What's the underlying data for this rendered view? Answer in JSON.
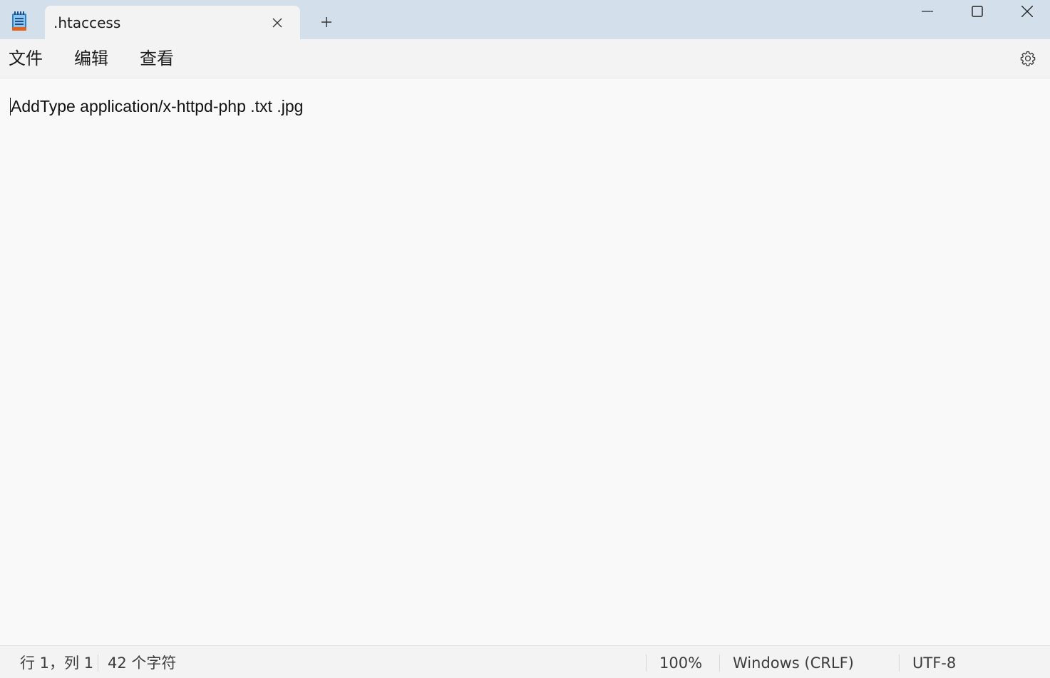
{
  "app": {
    "icon": "notepad-icon"
  },
  "tabs": [
    {
      "label": ".htaccess",
      "active": true
    }
  ],
  "menu": {
    "file": "文件",
    "edit": "编辑",
    "view": "查看"
  },
  "editor": {
    "content": "AddType application/x-httpd-php .txt .jpg"
  },
  "status": {
    "position": "行 1，列 1",
    "char_count": "42 个字符",
    "zoom": "100%",
    "line_ending": "Windows (CRLF)",
    "encoding": "UTF-8"
  },
  "colors": {
    "titlebar_bg": "#d3e0ec",
    "tab_bg": "#f3f3f3",
    "editor_bg": "#f9f9f9"
  }
}
